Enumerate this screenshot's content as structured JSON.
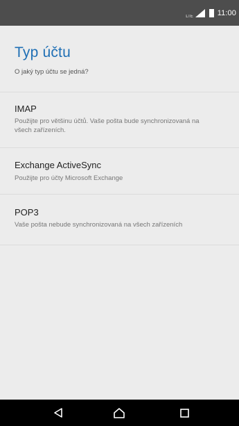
{
  "status_bar": {
    "network_label": "LTE",
    "time": "11:00",
    "icons": [
      "signal-icon",
      "battery-icon"
    ]
  },
  "header": {
    "title": "Typ účtu",
    "subtitle": "O jaký typ účtu se jedná?"
  },
  "account_types": [
    {
      "title": "IMAP",
      "description": "Použijte pro většinu účtů. Vaše pošta bude synchronizovaná na všech zařízeních."
    },
    {
      "title": "Exchange ActiveSync",
      "description": "Použijte pro účty Microsoft Exchange"
    },
    {
      "title": "POP3",
      "description": "Vaše pošta nebude synchronizovaná na všech zařízeních"
    }
  ],
  "navigation_bar": {
    "buttons": [
      "back-icon",
      "home-icon",
      "recent-apps-icon"
    ]
  },
  "colors": {
    "status_bar": "#4d4d4d",
    "background": "#ececec",
    "title_accent": "#1f6fb5",
    "nav_bar": "#000000",
    "divider": "#dcdcdc"
  }
}
